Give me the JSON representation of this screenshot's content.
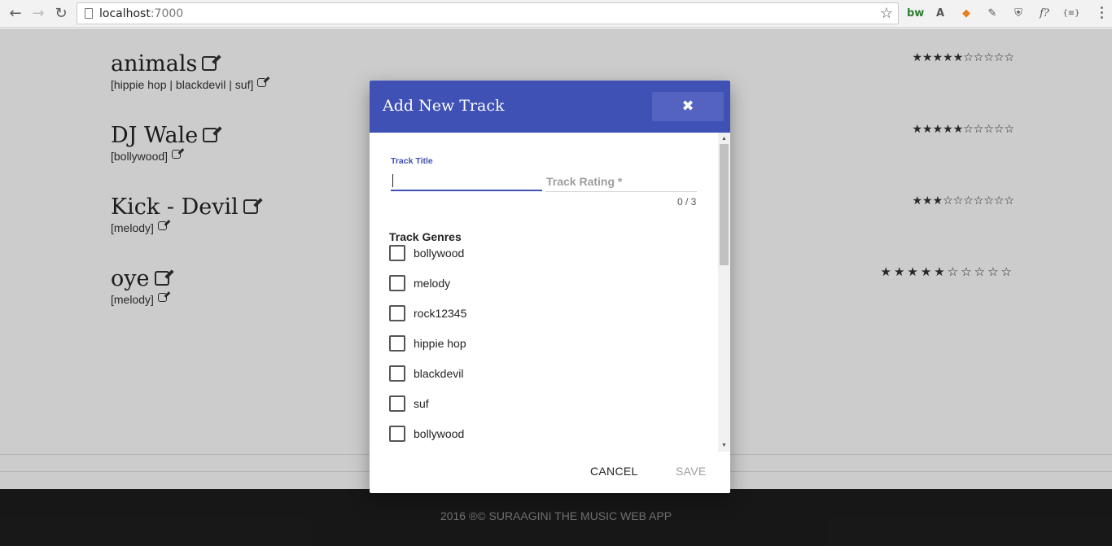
{
  "browser": {
    "url_host": "localhost",
    "url_port": ":7000",
    "extensions": [
      "bw",
      "A",
      "◆",
      "✎",
      "⛨",
      "f?",
      "{≡}"
    ]
  },
  "tracks": [
    {
      "title": "animals",
      "genres": "[hippie hop | blackdevil | suf]",
      "rating_stars": "★★★★★☆☆☆☆☆"
    },
    {
      "title": "DJ Wale",
      "genres": "[bollywood]",
      "rating_stars": "★★★★★☆☆☆☆☆"
    },
    {
      "title": "Kick - Devil",
      "genres": "[melody]",
      "rating_stars": "★★★☆☆☆☆☆☆☆"
    },
    {
      "title": "oye",
      "genres": "[melody]",
      "rating_stars": "★★★★★☆☆☆☆☆"
    }
  ],
  "footer": {
    "text": "2016 ®© SURAAGINI THE MUSIC WEB APP"
  },
  "dialog": {
    "title": "Add New Track",
    "close_symbol": "✖",
    "track_title_label": "Track Title",
    "track_title_value": "",
    "track_rating_placeholder": "Track Rating *",
    "char_counter": "0 / 3",
    "genres_heading": "Track Genres",
    "genres": [
      "bollywood",
      "melody",
      "rock12345",
      "hippie hop",
      "blackdevil",
      "suf",
      "bollywood"
    ],
    "cancel_label": "CANCEL",
    "save_label": "SAVE"
  },
  "colors": {
    "dialog_header": "#3f51b5",
    "focused_field": "#3f51b5",
    "footer_bg": "#212121"
  }
}
